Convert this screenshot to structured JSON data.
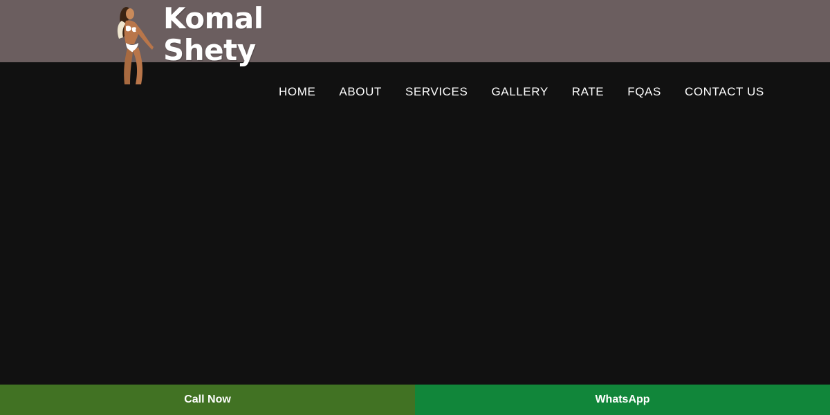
{
  "brand": {
    "name_line1": "Komal",
    "name_line2": "Shety",
    "logo_icon": "woman-figure-logo-icon"
  },
  "colors": {
    "header_band": "#6b5e5f",
    "page_background": "#111111",
    "nav_text": "#ffffff",
    "call_button": "#417223",
    "whatsapp_button": "#11863a"
  },
  "nav": {
    "items": [
      {
        "label": "HOME"
      },
      {
        "label": "ABOUT"
      },
      {
        "label": "SERVICES"
      },
      {
        "label": "GALLERY"
      },
      {
        "label": "RATE"
      },
      {
        "label": "FQAS"
      },
      {
        "label": "CONTACT US"
      }
    ]
  },
  "cta": {
    "call_label": "Call Now",
    "whatsapp_label": "WhatsApp"
  }
}
